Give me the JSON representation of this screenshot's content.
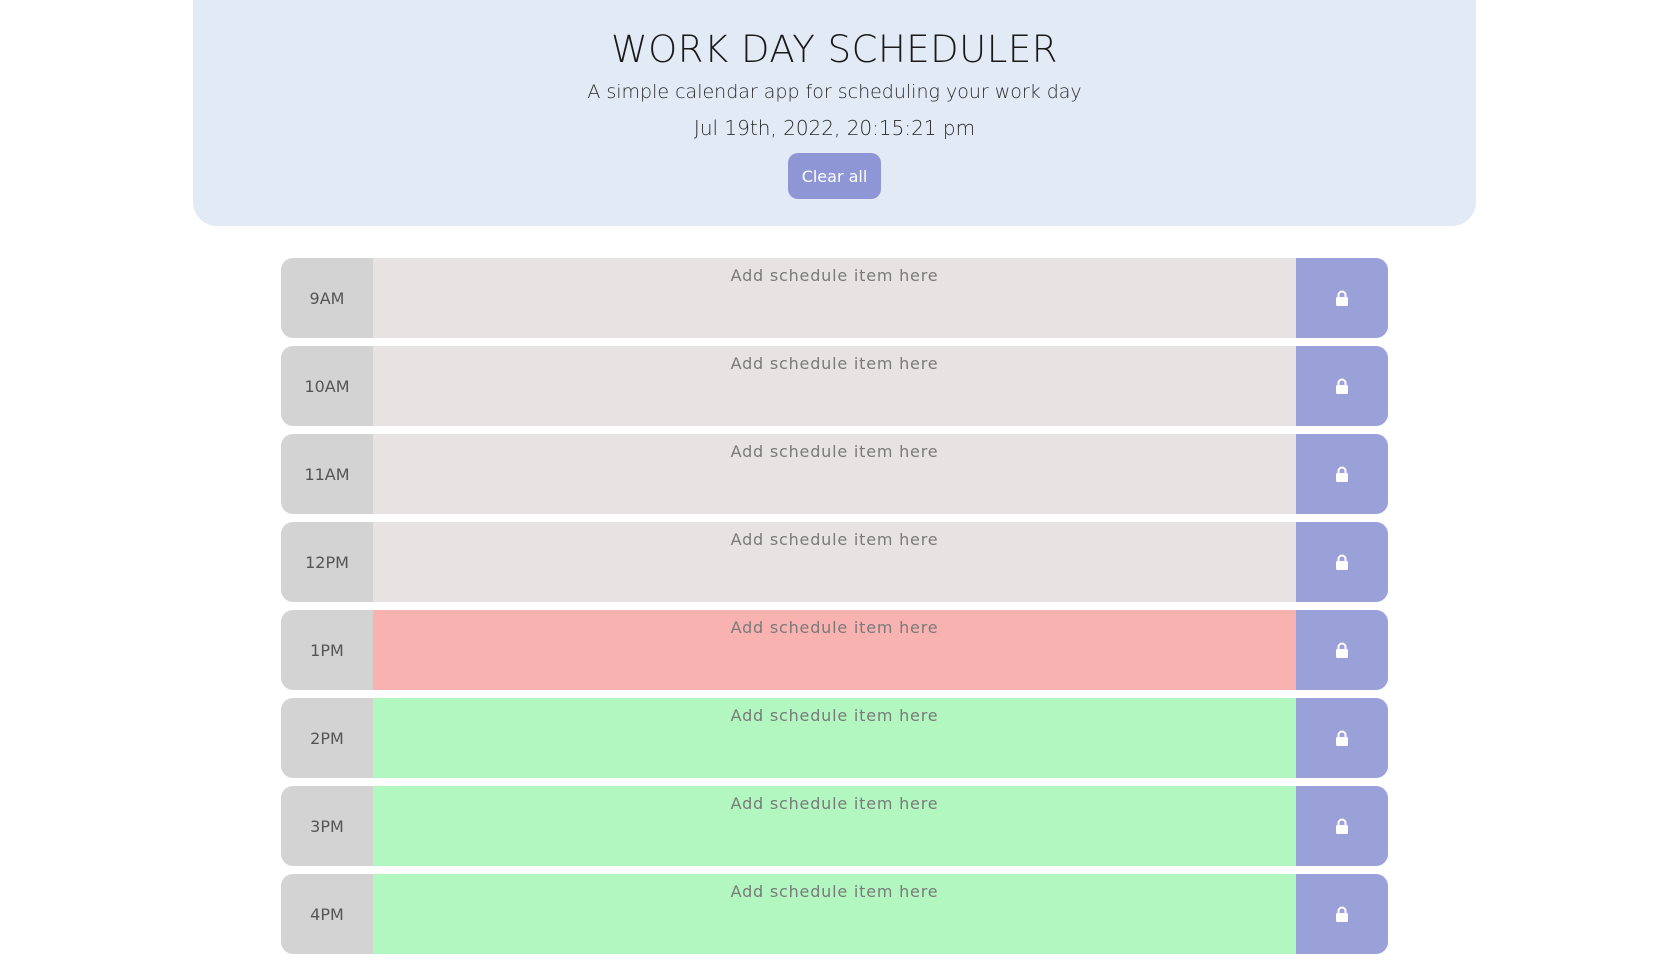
{
  "header": {
    "title": "WORK DAY SCHEDULER",
    "subtitle": "A simple calendar app for scheduling your work day",
    "datetime": "Jul 19th, 2022, 20:15:21 pm",
    "clear_label": "Clear all"
  },
  "placeholder": "Add schedule item here",
  "rows": [
    {
      "hour": "9AM",
      "state": "past"
    },
    {
      "hour": "10AM",
      "state": "past"
    },
    {
      "hour": "11AM",
      "state": "past"
    },
    {
      "hour": "12PM",
      "state": "past"
    },
    {
      "hour": "1PM",
      "state": "present"
    },
    {
      "hour": "2PM",
      "state": "future"
    },
    {
      "hour": "3PM",
      "state": "future"
    },
    {
      "hour": "4PM",
      "state": "future"
    }
  ],
  "colors": {
    "header_bg": "#e1eaf5",
    "button": "#8f96d6",
    "past": "#e7e3e2",
    "present": "#f8b2b0",
    "future": "#b2f7c0",
    "hour_bg": "#d3d3d3",
    "lock_bg": "#99a1d8"
  },
  "icons": {
    "save": "lock-icon"
  }
}
